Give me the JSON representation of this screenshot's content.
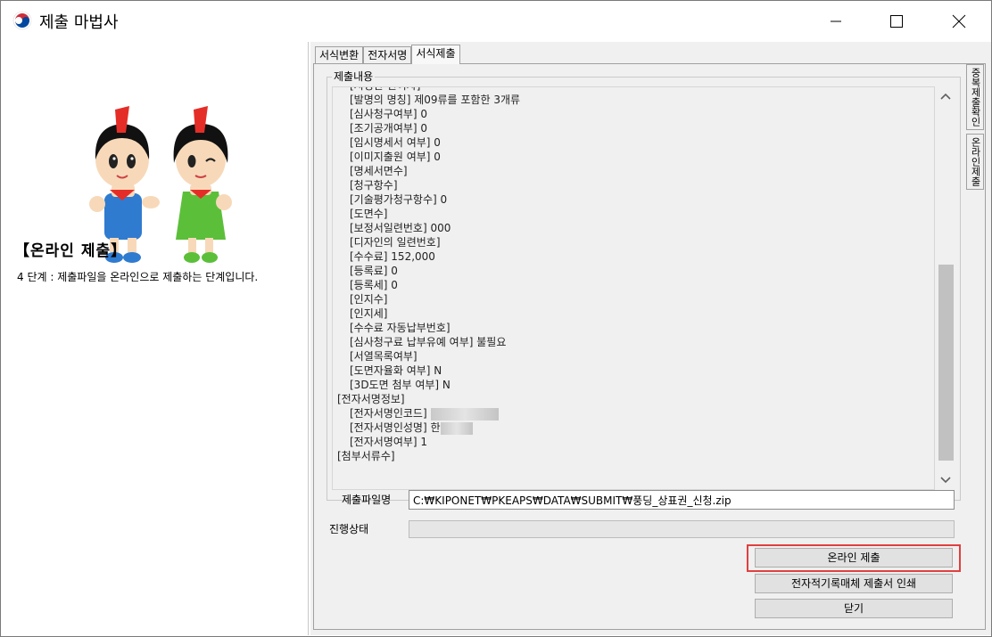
{
  "window": {
    "title": "제출 마법사",
    "controls": {
      "minimize": "minimize-icon",
      "maximize": "maximize-icon",
      "close": "close-icon"
    }
  },
  "left_panel": {
    "step_title": "【온라인 제출】",
    "step_description": "4 단계 : 제출파일을 온라인으로 제출하는 단계입니다."
  },
  "tabs": [
    {
      "label": "서식변환",
      "active": false
    },
    {
      "label": "전자서명",
      "active": false
    },
    {
      "label": "서식제출",
      "active": true
    }
  ],
  "side_tabs": [
    {
      "label": "중복제출확인"
    },
    {
      "label": "온라인제출"
    }
  ],
  "submission": {
    "group_label": "제출내용",
    "lines": [
      {
        "text": "[지정한 언어자]",
        "indent": true
      },
      {
        "text": "[발명의 명칭] 제09류를 포함한 3개류",
        "indent": true
      },
      {
        "text": "[심사청구여부] 0",
        "indent": true
      },
      {
        "text": "[조기공개여부] 0",
        "indent": true
      },
      {
        "text": "[임시명세서 여부] 0",
        "indent": true
      },
      {
        "text": "[이미지출원 여부] 0",
        "indent": true
      },
      {
        "text": "[명세서면수]",
        "indent": true
      },
      {
        "text": "[청구항수]",
        "indent": true
      },
      {
        "text": "[기술평가청구항수] 0",
        "indent": true
      },
      {
        "text": "[도면수]",
        "indent": true
      },
      {
        "text": "[보정서일련번호] 000",
        "indent": true
      },
      {
        "text": "[디자인의 일련번호]",
        "indent": true
      },
      {
        "text": "[수수료] 152,000",
        "indent": true
      },
      {
        "text": "[등록료] 0",
        "indent": true
      },
      {
        "text": "[등록세] 0",
        "indent": true
      },
      {
        "text": "[인지수]",
        "indent": true
      },
      {
        "text": "[인지세]",
        "indent": true
      },
      {
        "text": "[수수료 자동납부번호]",
        "indent": true
      },
      {
        "text": "[심사청구료 납부유예 여부] 불필요",
        "indent": true
      },
      {
        "text": "[서열목록여부]",
        "indent": true
      },
      {
        "text": "[도면자율화 여부] N",
        "indent": true
      },
      {
        "text": "[3D도면 첨부 여부] N",
        "indent": true
      },
      {
        "text": "[전자서명정보]",
        "indent": false
      },
      {
        "text": "[전자서명인코드]",
        "indent": true,
        "redacted": "wide"
      },
      {
        "text": "[전자서명인성명] 한",
        "indent": true,
        "redacted": "narrow"
      },
      {
        "text": "[전자서명여부] 1",
        "indent": true
      },
      {
        "text": "[첨부서류수]",
        "indent": false
      }
    ]
  },
  "file": {
    "label": "제출파일명",
    "value": "C:₩KIPONET₩PKEAPS₩DATA₩SUBMIT₩풍딩_상표권_신청.zip"
  },
  "progress": {
    "label": "진행상태",
    "value": 0
  },
  "buttons": {
    "submit": "온라인 제출",
    "print": "전자적기록매체 제출서 인쇄",
    "close": "닫기"
  },
  "colors": {
    "highlight": "#e0403f",
    "mascot_red": "#e52d27",
    "mascot_blue": "#2f7bd0",
    "mascot_green": "#5cbf3a"
  }
}
